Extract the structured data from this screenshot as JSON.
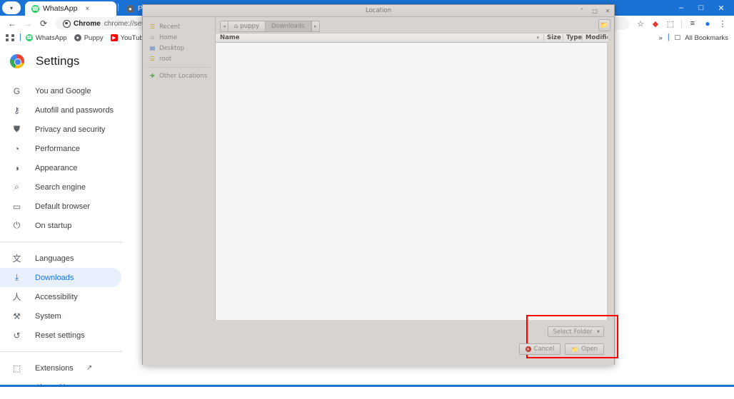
{
  "browser": {
    "tabs": [
      {
        "title": "WhatsApp",
        "favicon": "whatsapp-icon",
        "active": true,
        "close": "×"
      },
      {
        "title": "Puppy Li",
        "favicon": "puppy-icon",
        "active": false,
        "close": ""
      }
    ],
    "tab_dropdown_icon": "chevron-down-icon",
    "window_controls": {
      "minimize": "–",
      "maximize": "□",
      "close": "✕"
    },
    "toolbar": {
      "back_icon": "←",
      "forward_icon": "→",
      "reload_icon": "⟳",
      "omnibox_chip": "Chrome",
      "omnibox_url": "chrome://settings/do",
      "star_icon": "☆",
      "shield_icon": "◆",
      "extension_icon": "⬚",
      "split_icon": "≡",
      "profile_icon": "●",
      "menu_icon": "⋮"
    },
    "bookmarks": {
      "apps_icon": "apps-grid-icon",
      "items": [
        {
          "label": "WhatsApp",
          "favicon": "whatsapp-icon"
        },
        {
          "label": "Puppy",
          "favicon": "puppy-icon"
        },
        {
          "label": "YouTube",
          "favicon": "youtube-icon"
        },
        {
          "label": "",
          "favicon": "red-icon"
        }
      ],
      "overflow": "»",
      "all_bookmarks": "All Bookmarks",
      "folder_icon": "☐"
    }
  },
  "settings": {
    "title": "Settings",
    "logo": "chrome-logo",
    "nav": [
      {
        "label": "You and Google",
        "icon": "G",
        "selected": false
      },
      {
        "label": "Autofill and passwords",
        "icon": "⚷",
        "selected": false
      },
      {
        "label": "Privacy and security",
        "icon": "⛊",
        "selected": false
      },
      {
        "label": "Performance",
        "icon": "◔",
        "selected": false
      },
      {
        "label": "Appearance",
        "icon": "◑",
        "selected": false
      },
      {
        "label": "Search engine",
        "icon": "⌕",
        "selected": false
      },
      {
        "label": "Default browser",
        "icon": "▭",
        "selected": false
      },
      {
        "label": "On startup",
        "icon": "⏻",
        "selected": false
      }
    ],
    "nav2": [
      {
        "label": "Languages",
        "icon": "文",
        "selected": false
      },
      {
        "label": "Downloads",
        "icon": "⤓",
        "selected": true
      },
      {
        "label": "Accessibility",
        "icon": "人",
        "selected": false
      },
      {
        "label": "System",
        "icon": "⚒",
        "selected": false
      },
      {
        "label": "Reset settings",
        "icon": "↺",
        "selected": false
      }
    ],
    "nav3": [
      {
        "label": "Extensions",
        "icon": "⬚",
        "selected": false,
        "external": "↗"
      },
      {
        "label": "About Chrome",
        "icon": "◎",
        "selected": false,
        "external": ""
      }
    ]
  },
  "dialog": {
    "title": "Location",
    "window_controls": {
      "minimize": "˄",
      "maximize": "□",
      "close": "✕"
    },
    "places": [
      {
        "label": "Recent",
        "icon": "recent-icon"
      },
      {
        "label": "Home",
        "icon": "home-icon"
      },
      {
        "label": "Desktop",
        "icon": "desktop-icon"
      },
      {
        "label": "root",
        "icon": "folder-icon"
      }
    ],
    "places_other": {
      "label": "Other Locations",
      "icon": "other-locations-icon"
    },
    "pathbar": {
      "left_arrow": "◂",
      "right_arrow": "▸",
      "crumbs": [
        {
          "label": "puppy",
          "icon": "home-icon",
          "active": false
        },
        {
          "label": "Downloads",
          "icon": "",
          "active": true
        }
      ]
    },
    "new_folder_icon": "new-folder-icon",
    "columns": [
      {
        "label": "Name"
      },
      {
        "label": "Size"
      },
      {
        "label": "Type"
      },
      {
        "label": "Modified"
      }
    ],
    "sort_icon": "▾",
    "files": [],
    "footer": {
      "select_folder_label": "Select Folder",
      "select_folder_caret": "▾",
      "cancel_label": "Cancel",
      "cancel_icon": "✕",
      "open_label": "Open",
      "open_icon": "📁",
      "highlight_color": "#ff0000"
    }
  }
}
